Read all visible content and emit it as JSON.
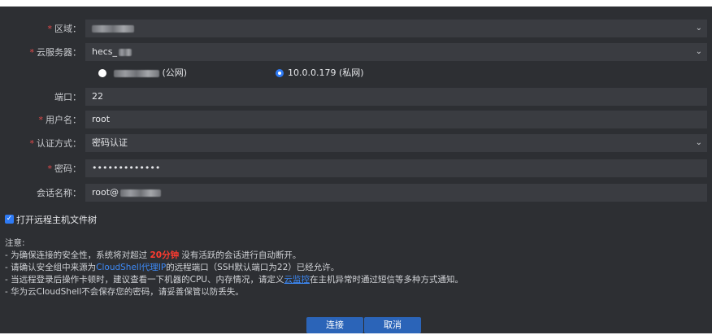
{
  "form": {
    "region": {
      "label": "区域：",
      "value": "",
      "required": true
    },
    "server": {
      "label": "云服务器：",
      "value": "hecs_",
      "required": true
    },
    "ip_public": {
      "suffix": "(公网)"
    },
    "ip_private": {
      "text": "10.0.0.179 (私网)"
    },
    "port": {
      "label": "端口：",
      "value": "22",
      "required": false
    },
    "username": {
      "label": "用户名：",
      "value": "root",
      "required": true
    },
    "auth": {
      "label": "认证方式：",
      "value": "密码认证",
      "required": true
    },
    "password": {
      "label": "密码：",
      "value": "•••••••••••••",
      "required": true
    },
    "session": {
      "label": "会话名称：",
      "value": "root@",
      "required": false
    }
  },
  "checkbox": {
    "label": "打开远程主机文件树",
    "checked": true
  },
  "notes": {
    "title": "注意:",
    "line1_a": "- 为确保连接的安全性，系统将对超过 ",
    "line1_b": "20分钟",
    "line1_c": " 没有活跃的会话进行自动断开。",
    "line2_a": "- 请确认安全组中来源为",
    "line2_b": "CloudShell代理IP",
    "line2_c": "的远程端口（SSH默认端口为22）已经允许。",
    "line3_a": "- 当远程登录后操作卡顿时，建议查看一下机器的CPU、内存情况，请定义",
    "line3_b": "云监控",
    "line3_c": "在主机异常时通过短信等多种方式通知。",
    "line4": "- 华为云CloudShell不会保存您的密码，请妥善保管以防丢失。"
  },
  "buttons": {
    "connect": "连接",
    "cancel": "取消"
  },
  "icons": {
    "dropdown": "chevron-down-icon",
    "check": "checkmark-icon"
  },
  "colors": {
    "accent": "#2f7bf5",
    "required": "#e34b4b",
    "warning": "#ff3b30",
    "button": "#2b64b8"
  }
}
